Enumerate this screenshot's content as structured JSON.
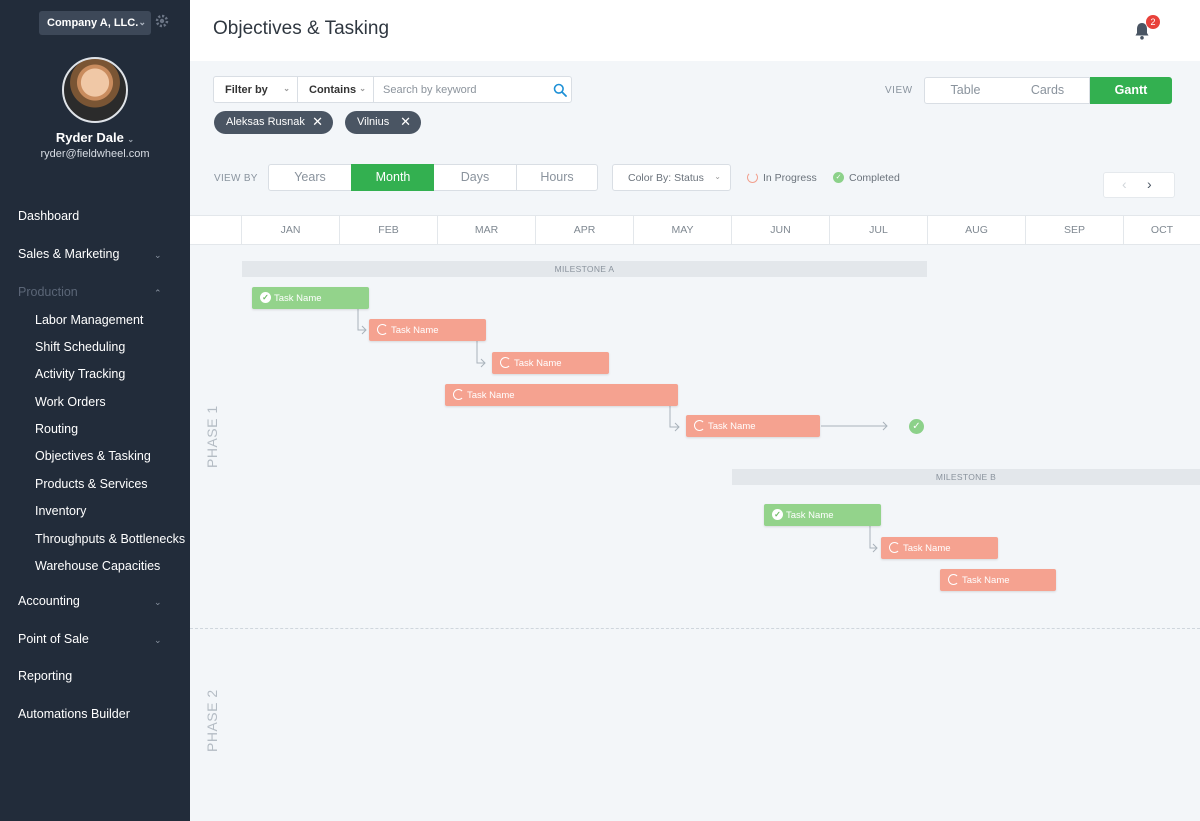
{
  "sidebar": {
    "company": "Company A, LLC.",
    "user_name": "Ryder Dale",
    "user_email": "ryder@fieldwheel.com",
    "nav": {
      "dashboard": "Dashboard",
      "sales": "Sales & Marketing",
      "production": "Production",
      "accounting": "Accounting",
      "pos": "Point of Sale",
      "reporting": "Reporting",
      "automations": "Automations Builder"
    },
    "production_items": [
      "Labor Management",
      "Shift Scheduling",
      "Activity Tracking",
      "Work Orders",
      "Routing",
      "Objectives & Tasking",
      "Products & Services",
      "Inventory",
      "Throughputs & Bottlenecks",
      "Warehouse Capacities"
    ]
  },
  "header": {
    "title": "Objectives & Tasking",
    "notification_count": "2"
  },
  "filters": {
    "filter_by": "Filter by",
    "contains": "Contains",
    "search_placeholder": "Search by keyword",
    "chips": [
      "Aleksas Rusnak",
      "Vilnius"
    ]
  },
  "view": {
    "label": "VIEW",
    "options": [
      "Table",
      "Cards",
      "Gantt"
    ],
    "active": "Gantt"
  },
  "view_by": {
    "label": "VIEW BY",
    "options": [
      "Years",
      "Month",
      "Days",
      "Hours"
    ],
    "active": "Month",
    "color_by": "Color By: Status",
    "legend": [
      "In Progress",
      "Completed"
    ]
  },
  "timeline": {
    "months": [
      "JAN",
      "FEB",
      "MAR",
      "APR",
      "MAY",
      "JUN",
      "JUL",
      "AUG",
      "SEP",
      "OCT"
    ],
    "milestones": [
      "MILESTONE A",
      "MILESTONE B"
    ],
    "phases": [
      "PHASE 1",
      "PHASE 2"
    ],
    "tasks": [
      {
        "name": "Task Name",
        "status": "completed"
      },
      {
        "name": "Task Name",
        "status": "in-progress"
      },
      {
        "name": "Task Name",
        "status": "in-progress"
      },
      {
        "name": "Task Name",
        "status": "in-progress"
      },
      {
        "name": "Task Name",
        "status": "in-progress"
      },
      {
        "name": "Task Name",
        "status": "completed"
      },
      {
        "name": "Task Name",
        "status": "in-progress"
      },
      {
        "name": "Task Name",
        "status": "in-progress"
      }
    ]
  },
  "colors": {
    "sidebar": "#222c3a",
    "accent_green": "#33b050",
    "completed": "#93d38b",
    "in_progress": "#f5a290",
    "badge": "#e8413a"
  }
}
